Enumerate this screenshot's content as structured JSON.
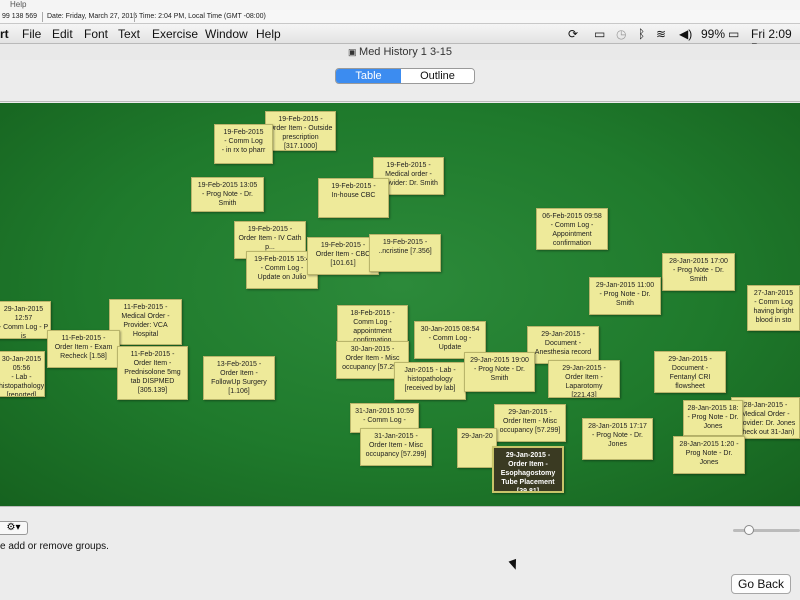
{
  "top_strip": {
    "text": "Help"
  },
  "info_bar": {
    "account": "99 138 569",
    "date": "Date: Friday, March 27, 2015",
    "time": "Time: 2:04 PM, Local Time (GMT -08:00)"
  },
  "menubar": {
    "items": [
      "rt",
      "File",
      "Edit",
      "Font",
      "Text",
      "Exercise",
      "Window",
      "Help"
    ],
    "battery": "99%",
    "clock": "Fri 2:09 P"
  },
  "window": {
    "title": "Med History 1 3-15"
  },
  "view_tabs": {
    "table": "Table View",
    "outline": "Outline View"
  },
  "notes": [
    {
      "text": "19-Feb-2015 -\nOrder Item - Outside\nprescription\n[317.1000]"
    },
    {
      "text": "19-Feb-2015\n- Comm Log\n- in rx to pharr"
    },
    {
      "text": "19-Feb-2015 -\nMedical order -\nProvider: Dr. Smith"
    },
    {
      "text": "19-Feb-2015 13:05\n- Prog Note - Dr.\nSmith"
    },
    {
      "text": "19-Feb-2015 -\nIn-house CBC"
    },
    {
      "text": "06-Feb-2015 09:58\n- Comm Log -\nAppointment\nconfirmation"
    },
    {
      "text": "19-Feb-2015 -\nOrder Item - IV Cath\np..."
    },
    {
      "text": "19-Feb-2015 15:4\n- Comm Log -\nUpdate on Julio"
    },
    {
      "text": "19-Feb-2015 -\nOrder Item - CBC\n[101.61]"
    },
    {
      "text": "19-Feb-2015 -\n..ncristine [7.356]"
    },
    {
      "text": "28-Jan-2015 17:00\n- Prog Note - Dr.\nSmith"
    },
    {
      "text": "29-Jan-2015 11:00\n- Prog Note - Dr.\nSmith"
    },
    {
      "text": "27-Jan-2015\n- Comm Log\nhaving bright\nblood in sto"
    },
    {
      "text": "29-Jan-2015 12:57\n- Comm Log - P is\nnot defecating"
    },
    {
      "text": "11-Feb-2015 -\nMedical Order -\nProvider: VCA\nHospital"
    },
    {
      "text": "18-Feb-2015 -\nComm Log -\nappointment\nconfirmation"
    },
    {
      "text": "11-Feb-2015 -\nOrder Item - Exam\nRecheck [1.58]"
    },
    {
      "text": "30-Jan-2015 08:54\n- Comm Log -\nUpdate"
    },
    {
      "text": "29-Jan-2015 -\nDocument -\nAnesthesia record"
    },
    {
      "text": "30-Jan-2015 05:56\n- Lab -\nhistopathology\n[reported]"
    },
    {
      "text": "11-Feb-2015 -\nOrder Item -\nPrednisolone 5mg\ntab DISPMED\n[305.139]"
    },
    {
      "text": "13-Feb-2015 -\nOrder Item -\nFollowUp Surgery\n[1.106]"
    },
    {
      "text": "30-Jan-2015 -\nOrder Item - Misc\noccupancy [57.299]"
    },
    {
      "text": "Jan-2015 - Lab -\nhistopathology\n[received by lab]"
    },
    {
      "text": "29-Jan-2015 19:00\n- Prog Note - Dr.\nSmith"
    },
    {
      "text": "29-Jan-2015 -\nOrder Item -\nLaparotomy\n[221.43]"
    },
    {
      "text": "29-Jan-2015 -\nDocument -\nFentanyl CRI\nflowsheet"
    },
    {
      "text": "31-Jan-2015 10:59\n- Comm Log -"
    },
    {
      "text": "29-Jan-2015 -\nOrder Item - Misc\noccupancy [57.299]"
    },
    {
      "text": "28-Jan-2015 17:17\n- Prog Note - Dr.\nJones"
    },
    {
      "text": "28-Jan-2015 -\nMedical Order -\nProvider: Dr. Jones\n(check out 31-Jan)"
    },
    {
      "text": "28-Jan-2015 18:\n- Prog Note - Dr.\nJones"
    },
    {
      "text": "31-Jan-2015 -\nOrder Item - Misc\noccupancy [57.299]"
    },
    {
      "text": "29-Jan-20"
    },
    {
      "text": "28-Jan-2015 1:20 -\nProg Note - Dr.\nJones"
    },
    {
      "text": "29-Jan-2015 -\nOrder Item -\nEsophagostomy\nTube Placement\n[39.81]"
    }
  ],
  "bottom": {
    "gear": "⚙▾",
    "help_text": "e add or remove groups.",
    "go_back": "Go Back"
  }
}
